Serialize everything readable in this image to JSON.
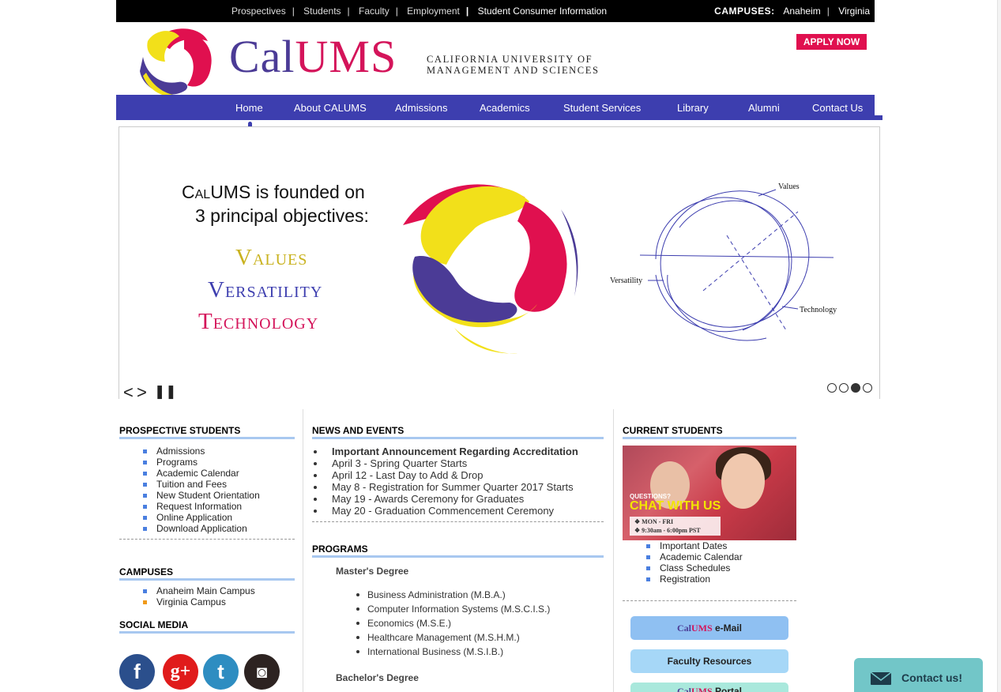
{
  "topbar": {
    "links": [
      "Prospectives",
      "Students",
      "Faculty",
      "Employment",
      "Student Consumer Information"
    ],
    "campuses_label": "CAMPUSES:",
    "campuses": [
      "Anaheim",
      "Virginia"
    ]
  },
  "header": {
    "logo_cal": "Cal",
    "logo_ums": "UMS",
    "sub_line1": "CALIFORNIA UNIVERSITY OF",
    "sub_line2": "MANAGEMENT AND SCIENCES",
    "apply_label": "APPLY NOW"
  },
  "nav": [
    "Home",
    "About CALUMS",
    "Admissions",
    "Academics",
    "Student Services",
    "Library",
    "Alumni",
    "Contact Us"
  ],
  "slider": {
    "head_cal": "Cal",
    "head_rest": "UMS is founded on",
    "head_line2": "3 principal objectives:",
    "obj1": "Values",
    "obj2": "Versatility",
    "obj3": "Technology",
    "diagram_values": "Values",
    "diagram_versatility": "Versatility",
    "diagram_technology": "Technology",
    "prev": "<",
    "next": ">",
    "pause": "❚❚"
  },
  "prospective": {
    "title": "PROSPECTIVE STUDENTS",
    "items": [
      "Admissions",
      "Programs",
      "Academic Calendar",
      "Tuition and Fees",
      "New Student Orientation",
      "Request Information",
      "Online Application",
      "Download Application"
    ]
  },
  "campuses": {
    "title": "CAMPUSES",
    "items": [
      "Anaheim Main Campus",
      "Virginia Campus"
    ]
  },
  "social": {
    "title": "SOCIAL MEDIA",
    "facebook": "f",
    "google": "g+",
    "twitter": "t",
    "instagram": "◙"
  },
  "news": {
    "title": "NEWS AND EVENTS",
    "items": [
      "Important Announcement Regarding Accreditation",
      "April   3 - Spring Quarter Starts",
      "April 12 - Last Day to Add & Drop",
      "May   8 - Registration for Summer Quarter 2017 Starts",
      "May 19 - Awards Ceremony for Graduates",
      "May 20 - Graduation Commencement Ceremony"
    ]
  },
  "programs": {
    "title": "PROGRAMS",
    "masters_label": "Master's Degree",
    "masters": [
      "Business Administration  (M.B.A.)",
      "Computer Information Systems   (M.S.C.I.S.)",
      "Economics   (M.S.E.)",
      "Healthcare Management   (M.S.H.M.)",
      "International Business   (M.S.I.B.)"
    ],
    "bachelors_label": "Bachelor's Degree"
  },
  "current": {
    "title": "CURRENT STUDENTS",
    "chat_q": "QUESTIONS?",
    "chat_title": "CHAT WITH US",
    "chat_days": "❖  MON - FRI",
    "chat_hours": "❖  9:30am - 6:00pm PST",
    "items": [
      "Important Dates",
      "Academic Calendar",
      "Class Schedules",
      "Registration"
    ],
    "email_cal": "Cal",
    "email_ums": "UMS",
    "email_rest": " e-Mail",
    "faculty": "Faculty Resources",
    "portal_cal": "Cal",
    "portal_ums": "UMS",
    "portal_rest": " Portal"
  },
  "contact_widget": {
    "label": "Contact us!"
  },
  "colors": {
    "nav": "#3d3eaf",
    "brand_purple": "#4b3b96",
    "brand_pink": "#d4145a",
    "brand_yellow": "#f2e01a",
    "apply": "#e0104f"
  }
}
